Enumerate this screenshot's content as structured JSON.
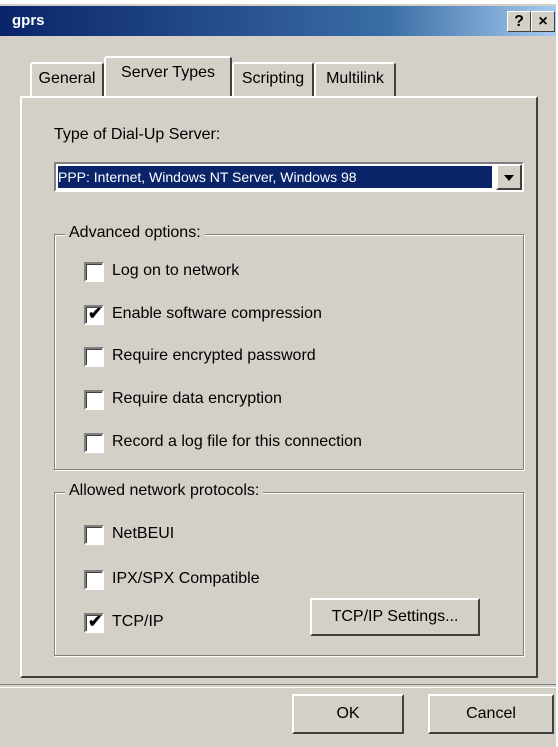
{
  "window": {
    "title": "gprs",
    "help_button": "?",
    "close_button": "×"
  },
  "tabs": [
    {
      "label": "General",
      "active": false
    },
    {
      "label": "Server Types",
      "active": true
    },
    {
      "label": "Scripting",
      "active": false
    },
    {
      "label": "Multilink",
      "active": false
    }
  ],
  "server_type": {
    "label": "Type of Dial-Up Server:",
    "selected": "PPP: Internet, Windows NT Server, Windows 98"
  },
  "advanced_options": {
    "legend": "Advanced options:",
    "items": [
      {
        "label": "Log on to network",
        "checked": false
      },
      {
        "label": "Enable software compression",
        "checked": true
      },
      {
        "label": "Require encrypted password",
        "checked": false
      },
      {
        "label": "Require data encryption",
        "checked": false
      },
      {
        "label": "Record a log file for this connection",
        "checked": false
      }
    ]
  },
  "protocols": {
    "legend": "Allowed network protocols:",
    "items": [
      {
        "label": "NetBEUI",
        "checked": false
      },
      {
        "label": "IPX/SPX Compatible",
        "checked": false
      },
      {
        "label": "TCP/IP",
        "checked": true
      }
    ],
    "settings_button": "TCP/IP Settings..."
  },
  "buttons": {
    "ok": "OK",
    "cancel": "Cancel"
  },
  "check_glyph": "✔"
}
